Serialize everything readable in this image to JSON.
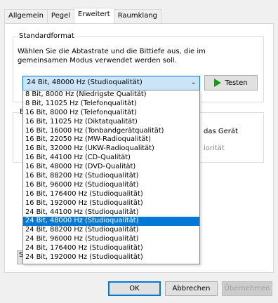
{
  "tabs": [
    "Allgemein",
    "Pegel",
    "Erweitert",
    "Raumklang"
  ],
  "standardformat": {
    "title": "Standardformat",
    "description": "Wählen Sie die Abtastrate und die Bittiefe aus, die im gemeinsamen Modus verwendet werden soll.",
    "selected": "24 Bit, 48000 Hz (Studioqualität)",
    "test_button": "Testen"
  },
  "background_partial": {
    "group_initial": "E",
    "exclusive_text": "das Gerät",
    "priority_text": "iorität",
    "stub_button": "S"
  },
  "dropdown_options": [
    "8 Bit, 8000 Hz (Niedrigste Qualität)",
    "8 Bit, 11025 Hz (Telefonqualität)",
    "16 Bit, 8000 Hz (Telefonqualität)",
    "16 Bit, 11025 Hz (Diktatqualität)",
    "16 Bit, 16000 Hz (Tonbandgerätqualität)",
    "16 Bit, 22050 Hz (MW-Radioqualität)",
    "16 Bit, 32000 Hz (UKW-Radioqualität)",
    "16 Bit, 44100 Hz (CD-Qualität)",
    "16 Bit, 48000 Hz (DVD-Qualität)",
    "16 Bit, 88200 Hz (Studioqualität)",
    "16 Bit, 96000 Hz (Studioqualität)",
    "16 Bit, 176400 Hz (Studioqualität)",
    "16 Bit, 192000 Hz (Studioqualität)",
    "24 Bit, 44100 Hz (Studioqualität)",
    "24 Bit, 48000 Hz (Studioqualität)",
    "24 Bit, 88200 Hz (Studioqualität)",
    "24 Bit, 96000 Hz (Studioqualität)",
    "24 Bit, 176400 Hz (Studioqualität)",
    "24 Bit, 192000 Hz (Studioqualität)"
  ],
  "selected_index": 14,
  "buttons": {
    "ok": "OK",
    "cancel": "Abbrechen",
    "apply": "Übernehmen"
  },
  "colors": {
    "accent": "#0078d7",
    "play_green": "#119d11"
  }
}
